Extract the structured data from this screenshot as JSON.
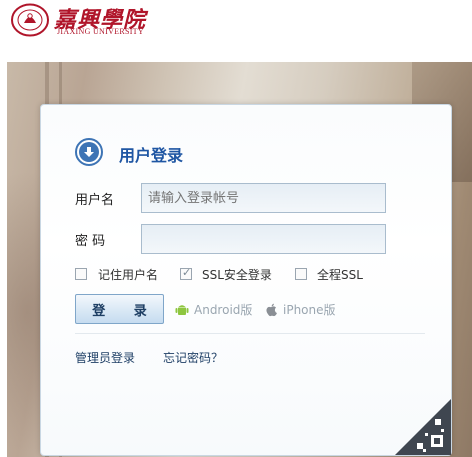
{
  "header": {
    "logo_cn": "嘉興學院",
    "logo_en": "JIAXING UNIVERSITY"
  },
  "login": {
    "title": "用户登录",
    "username_label": "用户名",
    "username_placeholder": "请输入登录帐号",
    "password_label": "密 码",
    "remember_label": "记住用户名",
    "ssl_label": "SSL安全登录",
    "ssl_checked": true,
    "fullssl_label": "全程SSL",
    "login_button": "登 录",
    "android_label": "Android版",
    "iphone_label": "iPhone版",
    "admin_login": "管理员登录",
    "forgot_password": "忘记密码？"
  },
  "colors": {
    "brand_red": "#b0152a",
    "accent_blue": "#1f56a3"
  },
  "icons": {
    "title_icon": "down-arrow-circle-icon",
    "android": "android-icon",
    "apple": "apple-icon",
    "qr": "qr-code-icon"
  }
}
